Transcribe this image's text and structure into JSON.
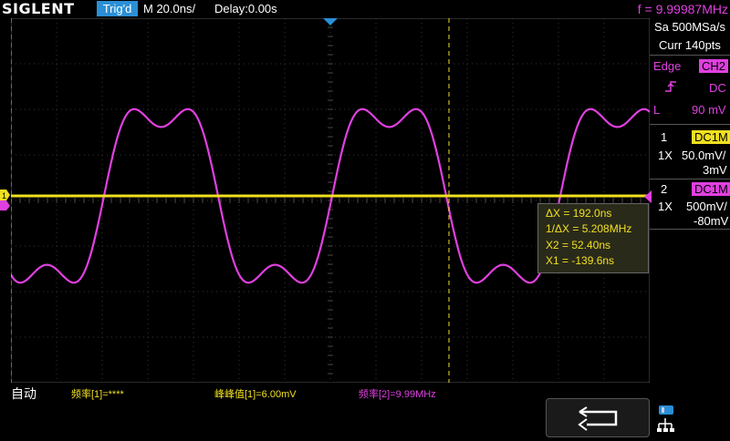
{
  "header": {
    "logo": "SIGLENT",
    "trigger_status": "Trig'd",
    "timebase": "M 20.0ns/",
    "delay": "Delay:0.00s",
    "frequency": "f = 9.99987MHz"
  },
  "acquisition": {
    "sample_rate": "Sa 500MSa/s",
    "memory_depth": "Curr 140pts"
  },
  "trigger": {
    "type": "Edge",
    "source": "CH2",
    "coupling": "DC",
    "level_label": "L",
    "level_value": "90 mV"
  },
  "channel1": {
    "number": "1",
    "coupling": "DC1M",
    "probe": "1X",
    "scale": "50.0mV/",
    "offset": "3mV"
  },
  "channel2": {
    "number": "2",
    "coupling": "DC1M",
    "probe": "1X",
    "scale": "500mV/",
    "offset": "-80mV"
  },
  "cursors": {
    "delta_x": "ΔX = 192.0ns",
    "inverse_delta_x": "1/ΔX = 5.208MHz",
    "x2": "X2 = 52.40ns",
    "x1": "X1 = -139.6ns"
  },
  "measurements": {
    "mode": "自动",
    "m1": "频率[1]=****",
    "m2": "峰峰值[1]=6.00mV",
    "m3": "频率[2]=9.99MHz"
  },
  "colors": {
    "ch1": "#f0e020",
    "ch2": "#e040e0",
    "accent": "#2a8fd6",
    "cursor1": "#f0e020",
    "cursor2": "#f0e020"
  },
  "icons": {
    "back": "back-arrow-icon",
    "network": "network-icon",
    "trigger_marker": "trigger-position-icon",
    "edge": "rising-edge-icon"
  }
}
